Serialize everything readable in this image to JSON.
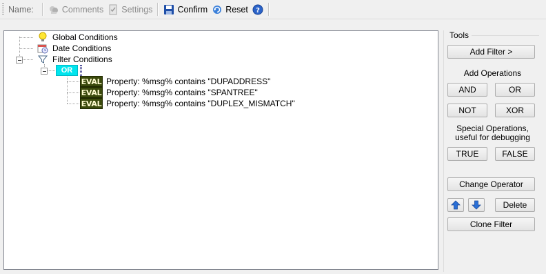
{
  "toolbar": {
    "name_label": "Name:",
    "comments_label": "Comments",
    "settings_label": "Settings",
    "confirm_label": "Confirm",
    "reset_label": "Reset",
    "help_icon": "help-icon"
  },
  "tree": {
    "global_conditions": "Global Conditions",
    "date_conditions": "Date Conditions",
    "filter_conditions": "Filter Conditions",
    "operator": "OR",
    "eval_badge": "EVAL",
    "evals": [
      "Property: %msg% contains \"DUPADDRESS\"",
      "Property: %msg% contains \"SPANTREE\"",
      "Property: %msg% contains \"DUPLEX_MISMATCH\""
    ]
  },
  "tools": {
    "title": "Tools",
    "add_filter": "Add Filter >",
    "add_operations": "Add Operations",
    "and": "AND",
    "or": "OR",
    "not": "NOT",
    "xor": "XOR",
    "special_line1": "Special Operations,",
    "special_line2": "useful for debugging",
    "true": "TRUE",
    "false": "FALSE",
    "change_operator": "Change Operator",
    "delete": "Delete",
    "clone_filter": "Clone Filter"
  },
  "colors": {
    "or_badge": "#00e5ee",
    "eval_badge_bg": "#3b4a0c",
    "eval_badge_fg": "#fffbd0",
    "arrow_blue": "#2a6fd6"
  }
}
